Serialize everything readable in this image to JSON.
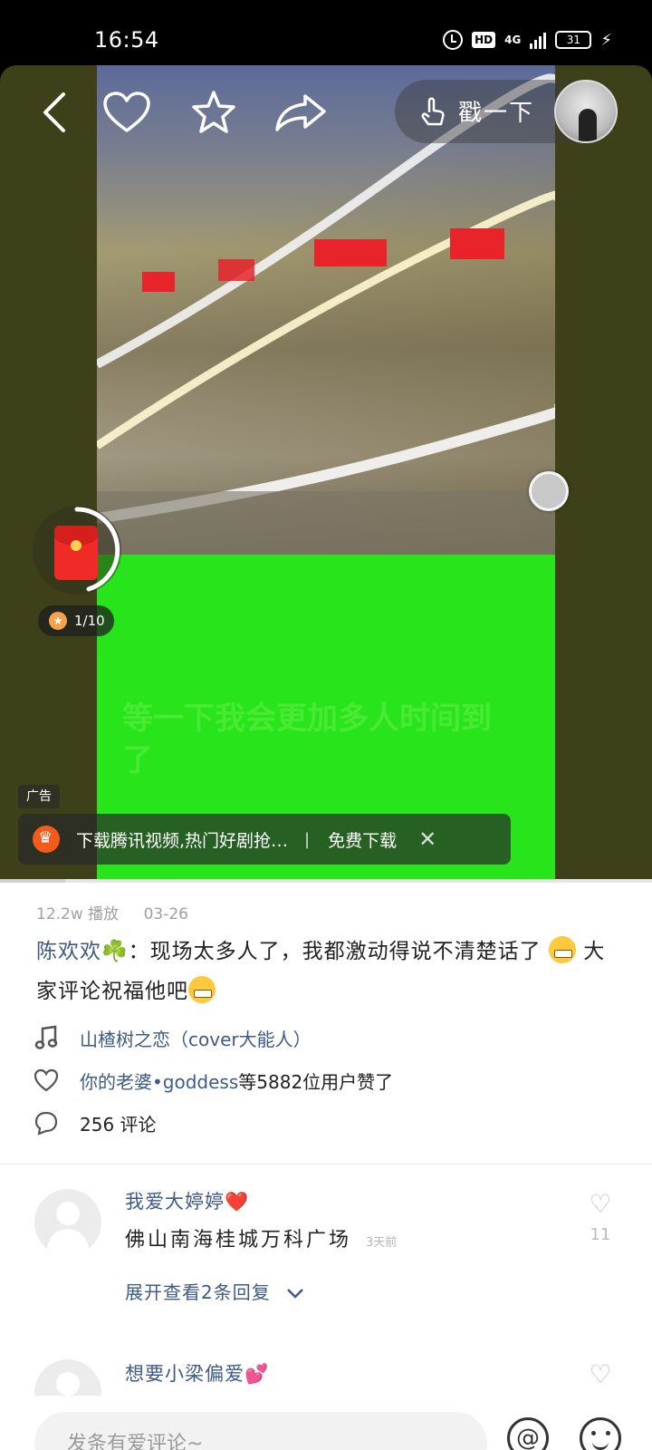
{
  "status_bar": {
    "time": "16:54",
    "hd": "HD",
    "network": "4G",
    "battery": "31"
  },
  "video": {
    "caption": "等一下我会更加多人时间到了",
    "poke_label": "戳一下",
    "red_envelope_progress": "1/10",
    "ad_tag": "广告",
    "ad_text": "下载腾讯视频,热门好剧抢…",
    "ad_separator": "|",
    "ad_cta": "免费下载",
    "progress_fraction": 0.1
  },
  "post": {
    "plays": "12.2w 播放",
    "date": "03-26",
    "author": "陈欢欢",
    "clover": "☘️",
    "colon": "：",
    "text_part1": "现场太多人了，我都激动得说不清楚话了",
    "text_part2": " 大家评论祝福他吧",
    "music": "山楂树之恋（cover大能人）",
    "like_user": "你的老婆•goddess",
    "like_suffix": " 等5882位用户赞了",
    "comments_count": "256 评论"
  },
  "comments": [
    {
      "name": "我爱大婷婷",
      "heart": "❤️",
      "text": "佛山南海桂城万科广场",
      "time": "3天前",
      "likes": "11",
      "expand": "展开查看2条回复"
    },
    {
      "name": "想要小梁偏爱",
      "heart": "💕",
      "text": "",
      "time": "",
      "likes": "",
      "expand": ""
    }
  ],
  "composer": {
    "placeholder": "发条有爱评论~",
    "at_symbol": "@"
  },
  "colors": {
    "link_blue": "#3e5a86",
    "green_overlay": "#27e51a",
    "side_olive": "#3d4019"
  }
}
